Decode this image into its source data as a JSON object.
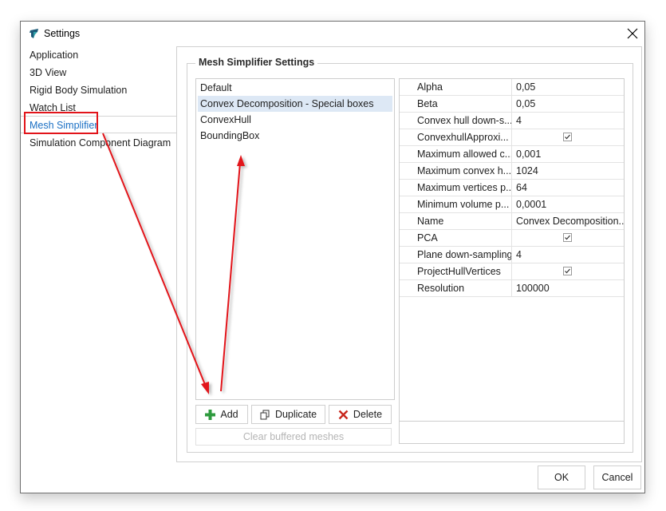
{
  "window": {
    "title": "Settings",
    "close_label": "×"
  },
  "nav": {
    "items": [
      {
        "label": "Application"
      },
      {
        "label": "3D View"
      },
      {
        "label": "Rigid Body Simulation"
      },
      {
        "label": "Watch List"
      },
      {
        "label": "Mesh Simplifier",
        "selected": true
      },
      {
        "label": "Simulation Component Diagram"
      }
    ]
  },
  "group": {
    "title": "Mesh Simplifier Settings"
  },
  "presets": {
    "items": [
      {
        "label": "Default"
      },
      {
        "label": "Convex Decomposition - Special boxes",
        "selected": true
      },
      {
        "label": "ConvexHull"
      },
      {
        "label": "BoundingBox"
      }
    ]
  },
  "buttons": {
    "add": "Add",
    "duplicate": "Duplicate",
    "delete": "Delete",
    "clear": "Clear buffered meshes",
    "ok": "OK",
    "cancel": "Cancel"
  },
  "properties": [
    {
      "name": "Alpha",
      "value": "0,05"
    },
    {
      "name": "Beta",
      "value": "0,05"
    },
    {
      "name": "Convex hull down-s...",
      "value": "4"
    },
    {
      "name": "ConvexhullApproxi...",
      "checked": true
    },
    {
      "name": "Maximum allowed c...",
      "value": "0,001"
    },
    {
      "name": "Maximum convex h...",
      "value": "1024"
    },
    {
      "name": "Maximum vertices p...",
      "value": "64"
    },
    {
      "name": "Minimum volume p...",
      "value": "0,0001"
    },
    {
      "name": "Name",
      "value": "Convex Decomposition..."
    },
    {
      "name": "PCA",
      "checked": true
    },
    {
      "name": "Plane down-sampling",
      "value": "4"
    },
    {
      "name": "ProjectHullVertices",
      "checked": true
    },
    {
      "name": "Resolution",
      "value": "100000"
    }
  ],
  "colors": {
    "accent": "#1a6fc4",
    "annotation": "#e2141a",
    "selection": "#dde8f5",
    "add_icon": "#2e9a3e",
    "delete_icon": "#c8261c"
  }
}
